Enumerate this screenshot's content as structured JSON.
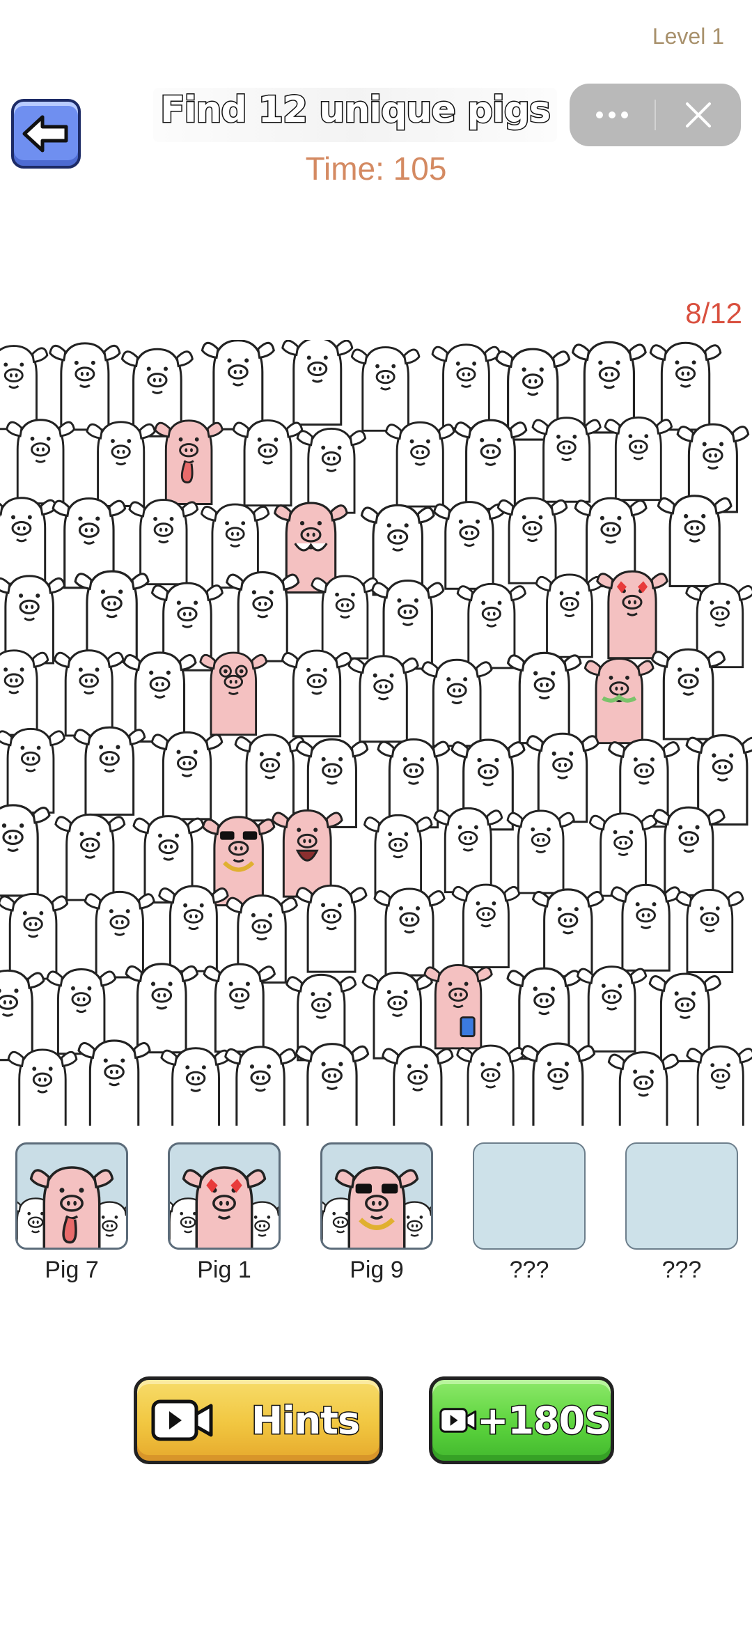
{
  "header": {
    "level_label": "Level 1",
    "title": "Find 12 unique pigs",
    "timer_text": "Time: 105",
    "more_icon": "ellipsis-icon",
    "close_icon": "close-icon",
    "back_icon": "arrow-left-icon"
  },
  "progress": {
    "text": "8/12",
    "found": 8,
    "total": 12
  },
  "found_slots": [
    {
      "label": "Pig 7",
      "variant": "tongue"
    },
    {
      "label": "Pig 1",
      "variant": "heart-eyes"
    },
    {
      "label": "Pig 9",
      "variant": "sunglasses"
    },
    {
      "label": "???",
      "variant": "empty"
    },
    {
      "label": "???",
      "variant": "empty"
    }
  ],
  "buttons": {
    "hints_label": "Hints",
    "time_label": "+180S",
    "camera_icon": "video-camera-icon"
  },
  "colors": {
    "pig_pink": "#f4c1c1",
    "hints_yellow": "#f1c640",
    "time_green": "#5cd43d",
    "timer": "#d48a62",
    "progress": "#d9503f",
    "slot_bg": "#c9dde6"
  }
}
